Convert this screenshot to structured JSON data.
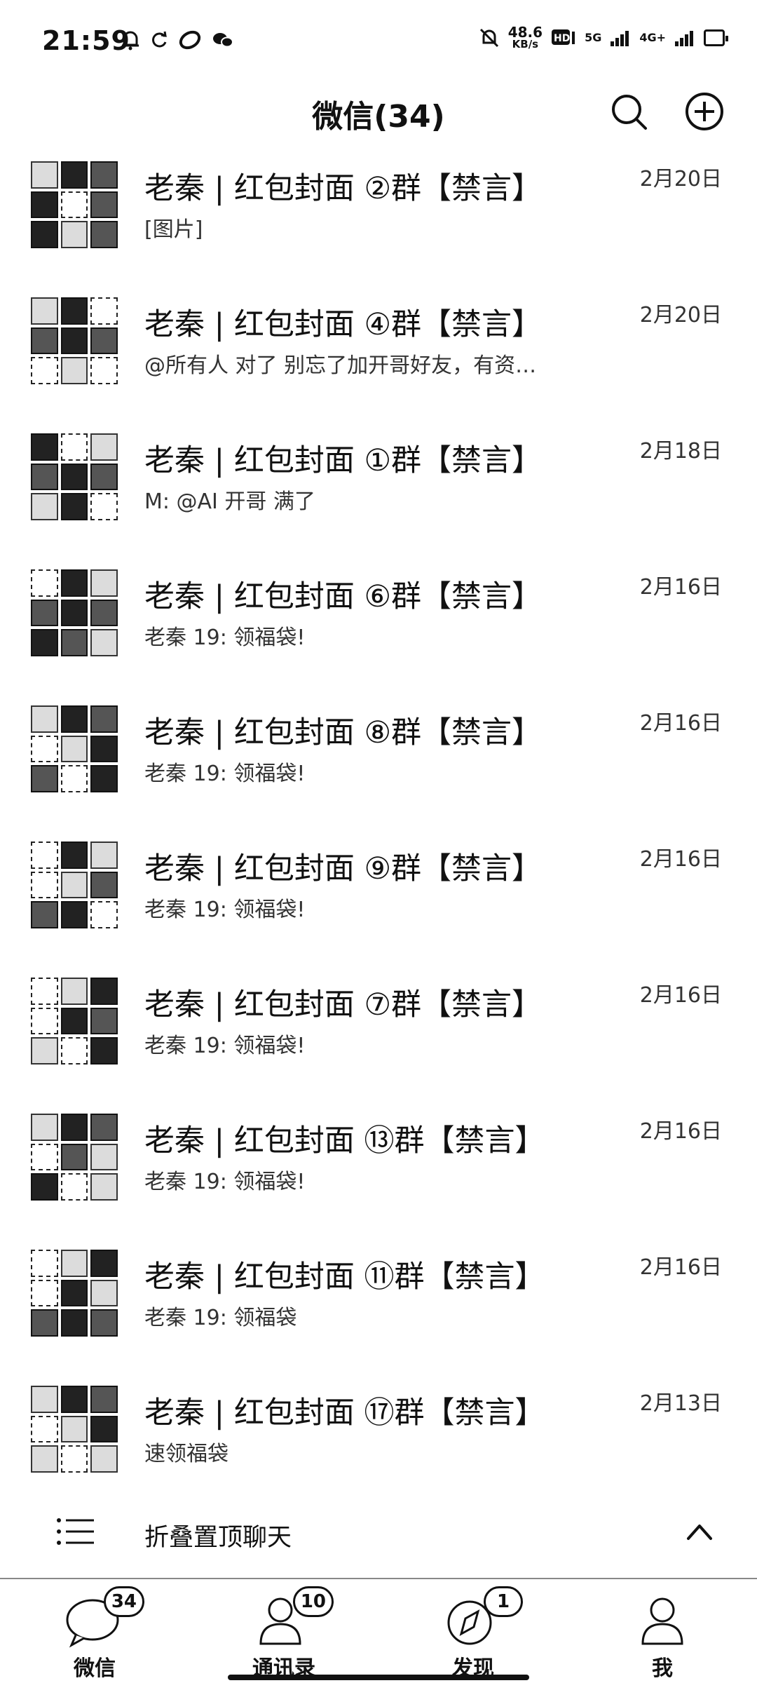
{
  "status_bar": {
    "time": "21:59",
    "speed_value": "48.6",
    "speed_unit": "KB/s",
    "hd_label": "HD",
    "net_5g": "5G",
    "net_4g": "4G+"
  },
  "header": {
    "title": "微信(34)",
    "icons": {
      "search": "search-icon",
      "add": "plus-circle-icon"
    }
  },
  "chats": [
    {
      "name": "老秦 | 红包封面 ②群【禁言】",
      "preview": "[图片]",
      "time": "2月20日"
    },
    {
      "name": "老秦 | 红包封面 ④群【禁言】",
      "preview": "@所有人 对了 别忘了加开哥好友，有资…",
      "time": "2月20日"
    },
    {
      "name": "老秦 | 红包封面 ①群【禁言】",
      "preview": "M: @AI 开哥 满了",
      "time": "2月18日"
    },
    {
      "name": "老秦 | 红包封面 ⑥群【禁言】",
      "preview": "老秦 19: 领福袋!",
      "time": "2月16日"
    },
    {
      "name": "老秦 | 红包封面 ⑧群【禁言】",
      "preview": "老秦 19: 领福袋!",
      "time": "2月16日"
    },
    {
      "name": "老秦 | 红包封面 ⑨群【禁言】",
      "preview": "老秦 19: 领福袋!",
      "time": "2月16日"
    },
    {
      "name": "老秦 | 红包封面 ⑦群【禁言】",
      "preview": "老秦 19: 领福袋!",
      "time": "2月16日"
    },
    {
      "name": "老秦 | 红包封面 ⑬群【禁言】",
      "preview": "老秦 19: 领福袋!",
      "time": "2月16日"
    },
    {
      "name": "老秦 | 红包封面 ⑪群【禁言】",
      "preview": "老秦 19: 领福袋",
      "time": "2月16日"
    },
    {
      "name": "老秦 | 红包封面 ⑰群【禁言】",
      "preview": "速领福袋",
      "time": "2月13日"
    }
  ],
  "fold_pinned": {
    "label": "折叠置顶聊天"
  },
  "tabs": [
    {
      "label": "微信",
      "badge": "34",
      "icon": "chat-bubble-icon"
    },
    {
      "label": "通讯录",
      "badge": "10",
      "icon": "contacts-icon"
    },
    {
      "label": "发现",
      "badge": "1",
      "icon": "compass-icon"
    },
    {
      "label": "我",
      "badge": "",
      "icon": "person-icon"
    }
  ]
}
